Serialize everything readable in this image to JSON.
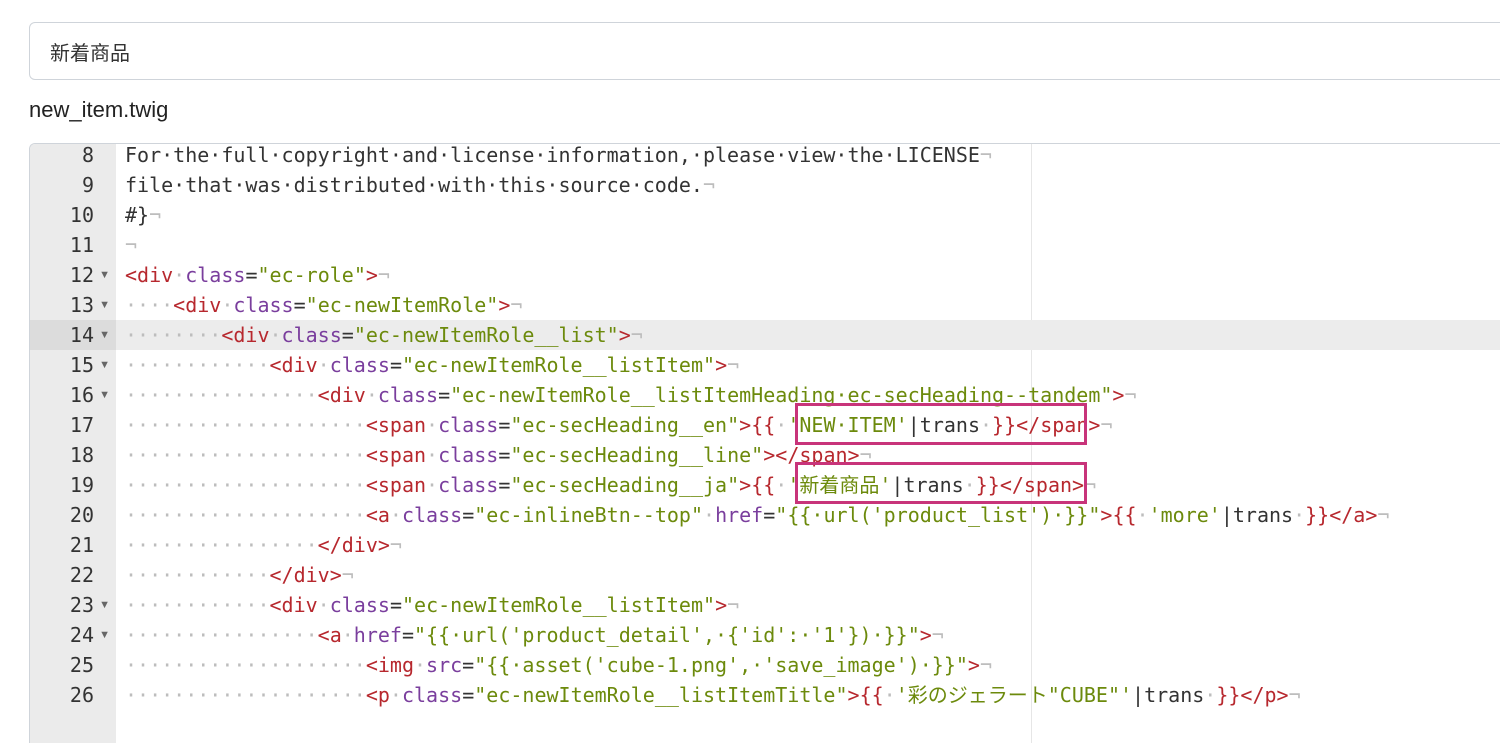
{
  "block_name_input": {
    "value": "新着商品"
  },
  "file_name": "new_item.twig",
  "editor": {
    "active_line": 14,
    "lines": [
      {
        "n": "8",
        "fold": false,
        "code": [
          [
            "t",
            "For·the·full·copyright·and·license·information,·please·view·the·LICENSE"
          ],
          [
            "ws",
            "¬"
          ]
        ]
      },
      {
        "n": "9",
        "fold": false,
        "code": [
          [
            "t",
            "file·that·was·distributed·with·this·source·code."
          ],
          [
            "ws",
            "¬"
          ]
        ]
      },
      {
        "n": "10",
        "fold": false,
        "code": [
          [
            "t",
            "#}"
          ],
          [
            "ws",
            "¬"
          ]
        ]
      },
      {
        "n": "11",
        "fold": false,
        "code": [
          [
            "ws",
            "¬"
          ]
        ]
      },
      {
        "n": "12",
        "fold": true,
        "code": [
          [
            "tag",
            "<div"
          ],
          [
            "ws",
            "·"
          ],
          [
            "attr",
            "class"
          ],
          [
            "t",
            "="
          ],
          [
            "str",
            "\"ec-role\""
          ],
          [
            "tag",
            ">"
          ],
          [
            "ws",
            "¬"
          ]
        ]
      },
      {
        "n": "13",
        "fold": true,
        "code": [
          [
            "ws",
            "····"
          ],
          [
            "tag",
            "<div"
          ],
          [
            "ws",
            "·"
          ],
          [
            "attr",
            "class"
          ],
          [
            "t",
            "="
          ],
          [
            "str",
            "\"ec-newItemRole\""
          ],
          [
            "tag",
            ">"
          ],
          [
            "ws",
            "¬"
          ]
        ]
      },
      {
        "n": "14",
        "fold": true,
        "code": [
          [
            "ws",
            "········"
          ],
          [
            "tag",
            "<div"
          ],
          [
            "ws",
            "·"
          ],
          [
            "attr",
            "class"
          ],
          [
            "t",
            "="
          ],
          [
            "str",
            "\"ec-newItemRole__list\""
          ],
          [
            "tag",
            ">"
          ],
          [
            "ws",
            "¬"
          ]
        ]
      },
      {
        "n": "15",
        "fold": true,
        "code": [
          [
            "ws",
            "············"
          ],
          [
            "tag",
            "<div"
          ],
          [
            "ws",
            "·"
          ],
          [
            "attr",
            "class"
          ],
          [
            "t",
            "="
          ],
          [
            "str",
            "\"ec-newItemRole__listItem\""
          ],
          [
            "tag",
            ">"
          ],
          [
            "ws",
            "¬"
          ]
        ]
      },
      {
        "n": "16",
        "fold": true,
        "code": [
          [
            "ws",
            "················"
          ],
          [
            "tag",
            "<div"
          ],
          [
            "ws",
            "·"
          ],
          [
            "attr",
            "class"
          ],
          [
            "t",
            "="
          ],
          [
            "str",
            "\"ec-newItemRole__listItemHeading·ec-secHeading--tandem\""
          ],
          [
            "tag",
            ">"
          ],
          [
            "ws",
            "¬"
          ]
        ]
      },
      {
        "n": "17",
        "fold": false,
        "code": [
          [
            "ws",
            "····················"
          ],
          [
            "tag",
            "<span"
          ],
          [
            "ws",
            "·"
          ],
          [
            "attr",
            "class"
          ],
          [
            "t",
            "="
          ],
          [
            "str",
            "\"ec-secHeading__en\""
          ],
          [
            "tag",
            ">"
          ],
          [
            "twig",
            "{{"
          ],
          [
            "ws",
            "·"
          ],
          [
            "str",
            "'NEW·ITEM'"
          ],
          [
            "t",
            "|trans"
          ],
          [
            "ws",
            "·"
          ],
          [
            "twig",
            "}}"
          ],
          [
            "tag",
            "</span>"
          ],
          [
            "ws",
            "¬"
          ]
        ]
      },
      {
        "n": "18",
        "fold": false,
        "code": [
          [
            "ws",
            "····················"
          ],
          [
            "tag",
            "<span"
          ],
          [
            "ws",
            "·"
          ],
          [
            "attr",
            "class"
          ],
          [
            "t",
            "="
          ],
          [
            "str",
            "\"ec-secHeading__line\""
          ],
          [
            "tag",
            "></span>"
          ],
          [
            "ws",
            "¬"
          ]
        ]
      },
      {
        "n": "19",
        "fold": false,
        "code": [
          [
            "ws",
            "····················"
          ],
          [
            "tag",
            "<span"
          ],
          [
            "ws",
            "·"
          ],
          [
            "attr",
            "class"
          ],
          [
            "t",
            "="
          ],
          [
            "str",
            "\"ec-secHeading__ja\""
          ],
          [
            "tag",
            ">"
          ],
          [
            "twig",
            "{{"
          ],
          [
            "ws",
            "·"
          ],
          [
            "str",
            "'新着商品'"
          ],
          [
            "t",
            "|trans"
          ],
          [
            "ws",
            "·"
          ],
          [
            "twig",
            "}}"
          ],
          [
            "tag",
            "</span>"
          ],
          [
            "ws",
            "¬"
          ]
        ]
      },
      {
        "n": "20",
        "fold": false,
        "code": [
          [
            "ws",
            "····················"
          ],
          [
            "tag",
            "<a"
          ],
          [
            "ws",
            "·"
          ],
          [
            "attr",
            "class"
          ],
          [
            "t",
            "="
          ],
          [
            "str",
            "\"ec-inlineBtn--top\""
          ],
          [
            "ws",
            "·"
          ],
          [
            "attr",
            "href"
          ],
          [
            "t",
            "="
          ],
          [
            "str",
            "\"{{·url('product_list')·}}\""
          ],
          [
            "tag",
            ">"
          ],
          [
            "twig",
            "{{"
          ],
          [
            "ws",
            "·"
          ],
          [
            "str",
            "'more'"
          ],
          [
            "t",
            "|trans"
          ],
          [
            "ws",
            "·"
          ],
          [
            "twig",
            "}}"
          ],
          [
            "tag",
            "</a>"
          ],
          [
            "ws",
            "¬"
          ]
        ]
      },
      {
        "n": "21",
        "fold": false,
        "code": [
          [
            "ws",
            "················"
          ],
          [
            "tag",
            "</div>"
          ],
          [
            "ws",
            "¬"
          ]
        ]
      },
      {
        "n": "22",
        "fold": false,
        "code": [
          [
            "ws",
            "············"
          ],
          [
            "tag",
            "</div>"
          ],
          [
            "ws",
            "¬"
          ]
        ]
      },
      {
        "n": "23",
        "fold": true,
        "code": [
          [
            "ws",
            "············"
          ],
          [
            "tag",
            "<div"
          ],
          [
            "ws",
            "·"
          ],
          [
            "attr",
            "class"
          ],
          [
            "t",
            "="
          ],
          [
            "str",
            "\"ec-newItemRole__listItem\""
          ],
          [
            "tag",
            ">"
          ],
          [
            "ws",
            "¬"
          ]
        ]
      },
      {
        "n": "24",
        "fold": true,
        "code": [
          [
            "ws",
            "················"
          ],
          [
            "tag",
            "<a"
          ],
          [
            "ws",
            "·"
          ],
          [
            "attr",
            "href"
          ],
          [
            "t",
            "="
          ],
          [
            "str",
            "\"{{·url('product_detail',·{'id':·'1'})·}}\""
          ],
          [
            "tag",
            ">"
          ],
          [
            "ws",
            "¬"
          ]
        ]
      },
      {
        "n": "25",
        "fold": false,
        "code": [
          [
            "ws",
            "····················"
          ],
          [
            "tag",
            "<img"
          ],
          [
            "ws",
            "·"
          ],
          [
            "attr",
            "src"
          ],
          [
            "t",
            "="
          ],
          [
            "str",
            "\"{{·asset('cube-1.png',·'save_image')·}}\""
          ],
          [
            "tag",
            ">"
          ],
          [
            "ws",
            "¬"
          ]
        ]
      },
      {
        "n": "26",
        "fold": false,
        "code": [
          [
            "ws",
            "····················"
          ],
          [
            "tag",
            "<p"
          ],
          [
            "ws",
            "·"
          ],
          [
            "attr",
            "class"
          ],
          [
            "t",
            "="
          ],
          [
            "str",
            "\"ec-newItemRole__listItemTitle\""
          ],
          [
            "tag",
            ">"
          ],
          [
            "twig",
            "{{"
          ],
          [
            "ws",
            "·"
          ],
          [
            "str",
            "'彩のジェラート\"CUBE\"'"
          ],
          [
            "t",
            "|trans"
          ],
          [
            "ws",
            "·"
          ],
          [
            "twig",
            "}}"
          ],
          [
            "tag",
            "</p>"
          ],
          [
            "ws",
            "¬"
          ]
        ]
      }
    ]
  },
  "colors": {
    "tag": "#b7282e",
    "attribute": "#7a3e9d",
    "string": "#6c8a0c",
    "whitespace_marker": "#bdbdbd",
    "highlight_box": "#c8347a"
  }
}
